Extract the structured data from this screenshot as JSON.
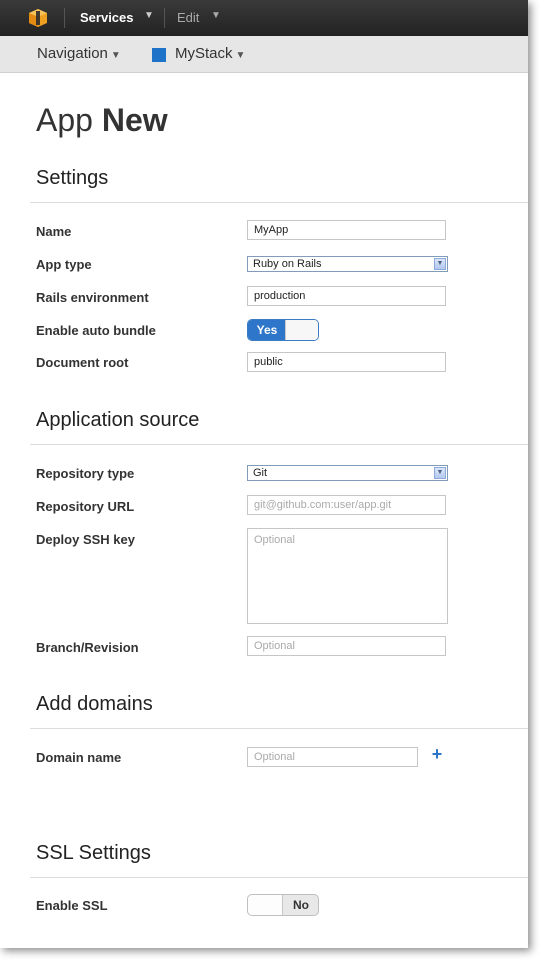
{
  "topbar": {
    "logo_icon": "aws-cube-icon",
    "services_label": "Services",
    "edit_label": "Edit",
    "chevron": "▼"
  },
  "navbar": {
    "navigation_label": "Navigation",
    "stack_label": "MyStack",
    "stack_color": "#1e73c8",
    "chevron": "▼"
  },
  "page": {
    "title_light": "App",
    "title_bold": "New"
  },
  "settings": {
    "title": "Settings",
    "name_label": "Name",
    "name_value": "MyApp",
    "app_type_label": "App type",
    "app_type_value": "Ruby on Rails",
    "rails_env_label": "Rails environment",
    "rails_env_value": "production",
    "auto_bundle_label": "Enable auto bundle",
    "auto_bundle_state": "Yes",
    "doc_root_label": "Document root",
    "doc_root_value": "public"
  },
  "source": {
    "title": "Application source",
    "repo_type_label": "Repository type",
    "repo_type_value": "Git",
    "repo_url_label": "Repository URL",
    "repo_url_placeholder": "git@github.com:user/app.git",
    "ssh_key_label": "Deploy SSH key",
    "ssh_key_placeholder": "Optional",
    "branch_label": "Branch/Revision",
    "branch_placeholder": "Optional"
  },
  "domains": {
    "title": "Add domains",
    "domain_label": "Domain name",
    "domain_placeholder": "Optional",
    "add_icon": "plus-icon"
  },
  "ssl": {
    "title": "SSL Settings",
    "enable_label": "Enable SSL",
    "enable_state": "No"
  },
  "colors": {
    "accent": "#2d76c9",
    "topbar": "#2b2b2b",
    "navbar": "#e6e6e6"
  }
}
